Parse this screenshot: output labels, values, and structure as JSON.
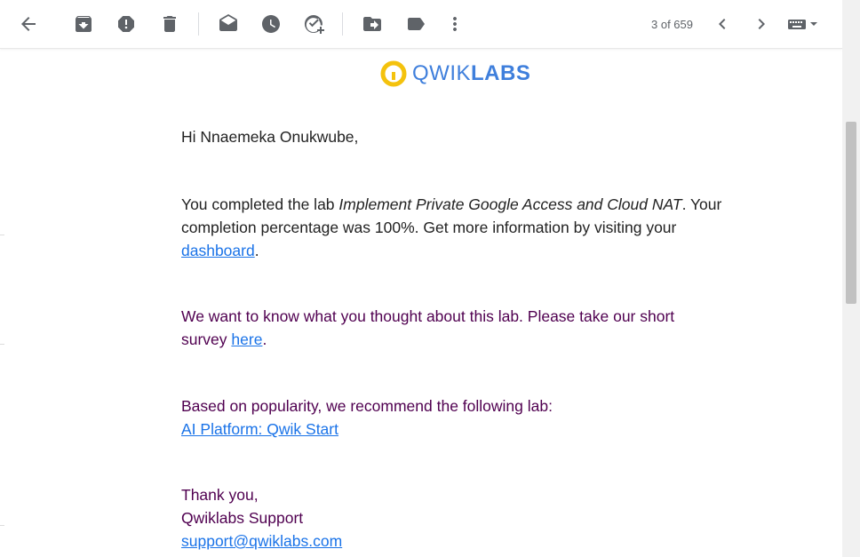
{
  "toolbar": {
    "pagination": "3 of 659",
    "icons": [
      "back-arrow-icon",
      "archive-icon",
      "report-spam-icon",
      "delete-icon",
      "mark-unread-icon",
      "snooze-icon",
      "add-to-tasks-icon",
      "move-to-icon",
      "label-icon",
      "more-vert-icon",
      "chevron-left-icon",
      "chevron-right-icon",
      "keyboard-icon"
    ]
  },
  "brand": {
    "logo_part1": "QWIK",
    "logo_part2": "LABS",
    "color": "#3f7fdc",
    "ring_color": "#f4c20d"
  },
  "email": {
    "greeting": "Hi Nnaemeka Onukwube,",
    "completion": {
      "before": "You completed the lab ",
      "lab_name": "Implement Private Google Access and Cloud NAT",
      "after": ". Your completion percentage was 100%. Get more information by visiting your ",
      "link": "dashboard",
      "end": "."
    },
    "survey": {
      "before": "We want to know what you thought about this lab. Please take our short survey ",
      "link": "here",
      "end": "."
    },
    "recommend": {
      "text": "Based on popularity, we recommend the following lab:",
      "link": "AI Platform: Qwik Start"
    },
    "signoff": {
      "thanks": "Thank you,",
      "team": "Qwiklabs Support",
      "email_link": "support@qwiklabs.com"
    }
  }
}
